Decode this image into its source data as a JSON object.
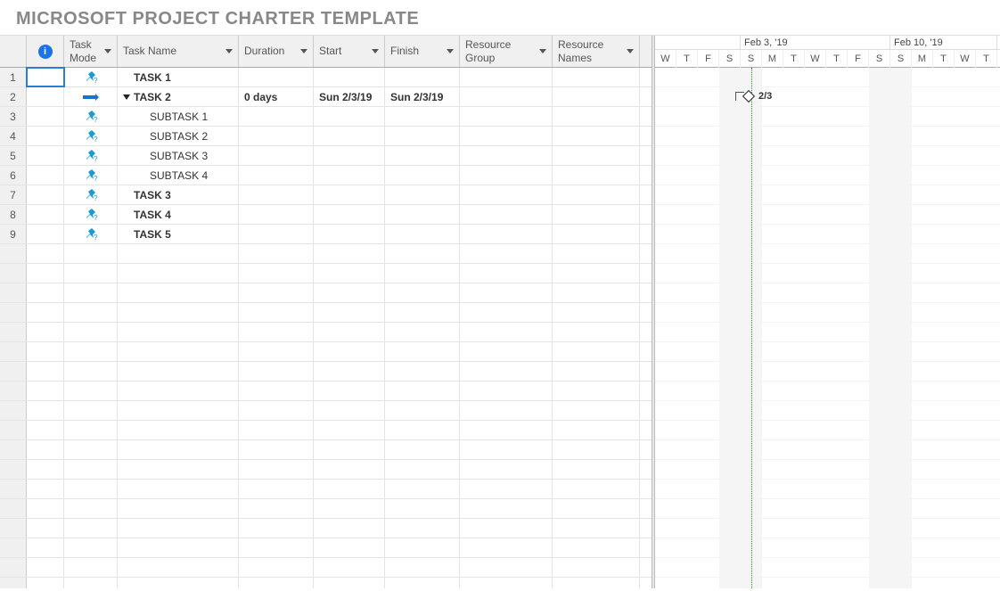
{
  "title": "MICROSOFT PROJECT CHARTER TEMPLATE",
  "columns": {
    "info": "i",
    "mode": "Task Mode",
    "name": "Task Name",
    "duration": "Duration",
    "start": "Start",
    "finish": "Finish",
    "group": "Resource Group",
    "names": "Resource Names"
  },
  "rows": [
    {
      "num": "1",
      "mode": "manual",
      "indent": 1,
      "bold": true,
      "collapse": false,
      "name": "TASK 1",
      "duration": "",
      "start": "",
      "finish": ""
    },
    {
      "num": "2",
      "mode": "auto",
      "indent": 0,
      "bold": true,
      "collapse": true,
      "name": "TASK 2",
      "duration": "0 days",
      "start": "Sun 2/3/19",
      "finish": "Sun 2/3/19"
    },
    {
      "num": "3",
      "mode": "manual",
      "indent": 2,
      "bold": false,
      "collapse": false,
      "name": "SUBTASK 1",
      "duration": "",
      "start": "",
      "finish": ""
    },
    {
      "num": "4",
      "mode": "manual",
      "indent": 2,
      "bold": false,
      "collapse": false,
      "name": "SUBTASK 2",
      "duration": "",
      "start": "",
      "finish": ""
    },
    {
      "num": "5",
      "mode": "manual",
      "indent": 2,
      "bold": false,
      "collapse": false,
      "name": "SUBTASK 3",
      "duration": "",
      "start": "",
      "finish": ""
    },
    {
      "num": "6",
      "mode": "manual",
      "indent": 2,
      "bold": false,
      "collapse": false,
      "name": "SUBTASK 4",
      "duration": "",
      "start": "",
      "finish": ""
    },
    {
      "num": "7",
      "mode": "manual",
      "indent": 1,
      "bold": true,
      "collapse": false,
      "name": "TASK 3",
      "duration": "",
      "start": "",
      "finish": ""
    },
    {
      "num": "8",
      "mode": "manual",
      "indent": 1,
      "bold": true,
      "collapse": false,
      "name": "TASK 4",
      "duration": "",
      "start": "",
      "finish": ""
    },
    {
      "num": "9",
      "mode": "manual",
      "indent": 1,
      "bold": true,
      "collapse": false,
      "name": "TASK 5",
      "duration": "",
      "start": "",
      "finish": ""
    }
  ],
  "empty_rows": 18,
  "timeline": {
    "day_width": 24,
    "top": [
      {
        "label": "",
        "days": 4
      },
      {
        "label": "Feb 3, '19",
        "days": 7
      },
      {
        "label": "Feb 10, '19",
        "days": 5
      }
    ],
    "days": [
      "W",
      "T",
      "F",
      "S",
      "S",
      "M",
      "T",
      "W",
      "T",
      "F",
      "S",
      "S",
      "M",
      "T",
      "W",
      "T"
    ],
    "weekend_indices": [
      3,
      4,
      10,
      11
    ],
    "today_index": 4,
    "milestone": {
      "row": 1,
      "day_index": 4,
      "label": "2/3"
    }
  }
}
